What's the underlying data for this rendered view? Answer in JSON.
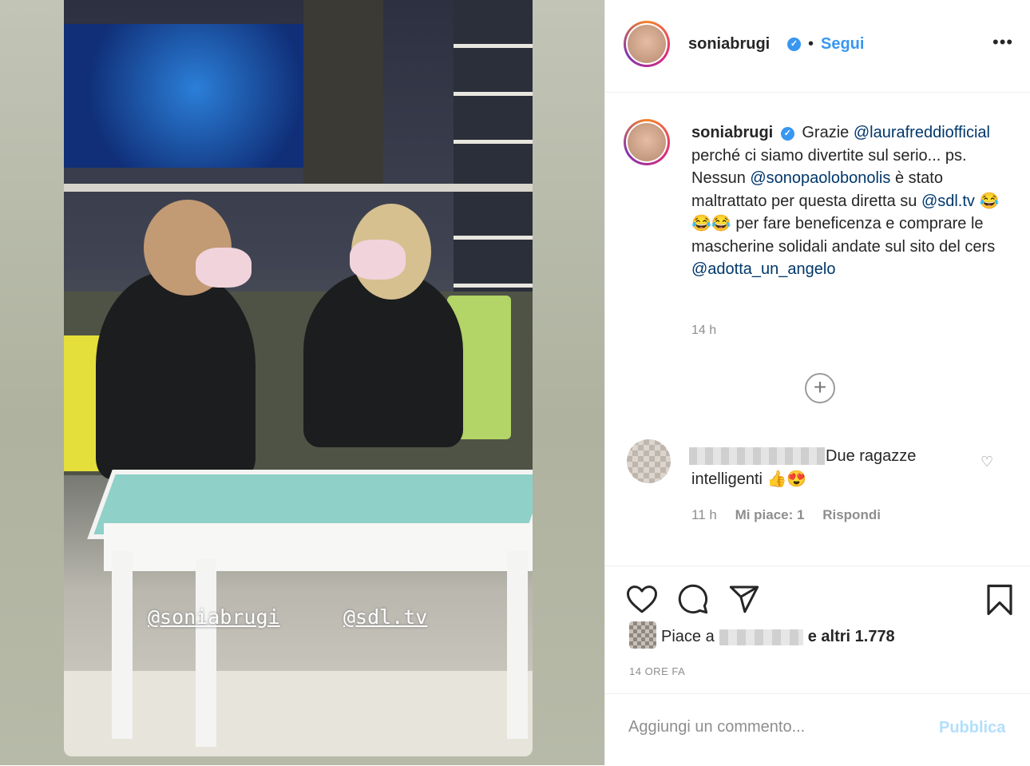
{
  "photo": {
    "tags": [
      "@soniabrugi",
      "@sdl.tv"
    ]
  },
  "header": {
    "username": "soniabrugi",
    "separator": "•",
    "follow_label": "Segui",
    "more_label": "•••"
  },
  "caption": {
    "username": "soniabrugi",
    "text_1": "Grazie",
    "mention_1": "@laurafreddiofficial",
    "text_2": "perché ci siamo divertite sul serio... ps. Nessun",
    "mention_2": "@sonopaolobonolis",
    "text_3": "è stato maltrattato per questa diretta su",
    "mention_3": "@sdl.tv",
    "emoji": "😂😂😂",
    "text_4": "per fare beneficenza e comprare le mascherine solidali andate sul sito del cers",
    "mention_4": "@adotta_un_angelo",
    "time": "14 h"
  },
  "load_more": "+",
  "comment": {
    "text": "Due ragazze intelligenti 👍😍",
    "time": "11 h",
    "likes": "Mi piace: 1",
    "reply": "Rispondi"
  },
  "likes": {
    "prefix": "Piace a",
    "suffix": "e altri 1.778"
  },
  "timestamp": "14 ORE FA",
  "comment_box": {
    "placeholder": "Aggiungi un commento...",
    "publish_label": "Pubblica"
  },
  "colors": {
    "accent": "#3897f0",
    "publish_disabled": "#b2dffc",
    "mention": "#00376b"
  }
}
